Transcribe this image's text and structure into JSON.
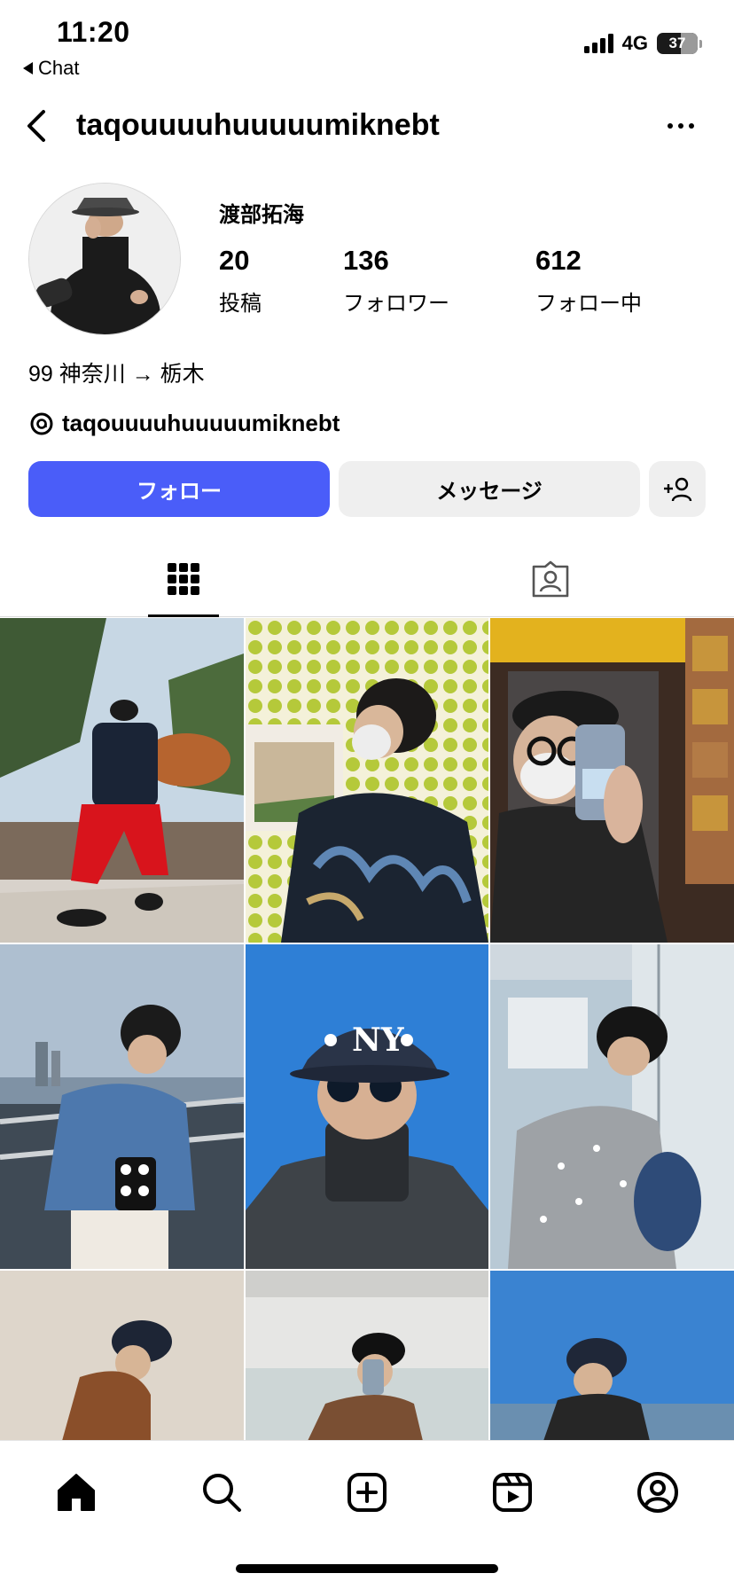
{
  "status_bar": {
    "time": "11:20",
    "back_app": "Chat",
    "network": "4G",
    "battery": "37"
  },
  "header": {
    "username": "taqouuuuhuuuuumiknebt"
  },
  "profile": {
    "display_name": "渡部拓海",
    "stats": [
      {
        "value": "20",
        "label": "投稿"
      },
      {
        "value": "136",
        "label": "フォロワー"
      },
      {
        "value": "612",
        "label": "フォロー中"
      }
    ],
    "bio": "99 神奈川 → 栃木",
    "threads_handle": "taqouuuuhuuuuumiknebt"
  },
  "actions": {
    "follow_label": "フォロー",
    "message_label": "メッセージ"
  },
  "tabs": [
    {
      "icon": "grid-icon",
      "active": true
    },
    {
      "icon": "tagged-icon",
      "active": false
    }
  ],
  "bottom_nav": [
    {
      "icon": "home-icon"
    },
    {
      "icon": "search-icon"
    },
    {
      "icon": "create-icon"
    },
    {
      "icon": "reels-icon"
    },
    {
      "icon": "profile-icon"
    }
  ],
  "colors": {
    "accent_blue": "#4a5df9",
    "secondary_button": "#efefef"
  }
}
